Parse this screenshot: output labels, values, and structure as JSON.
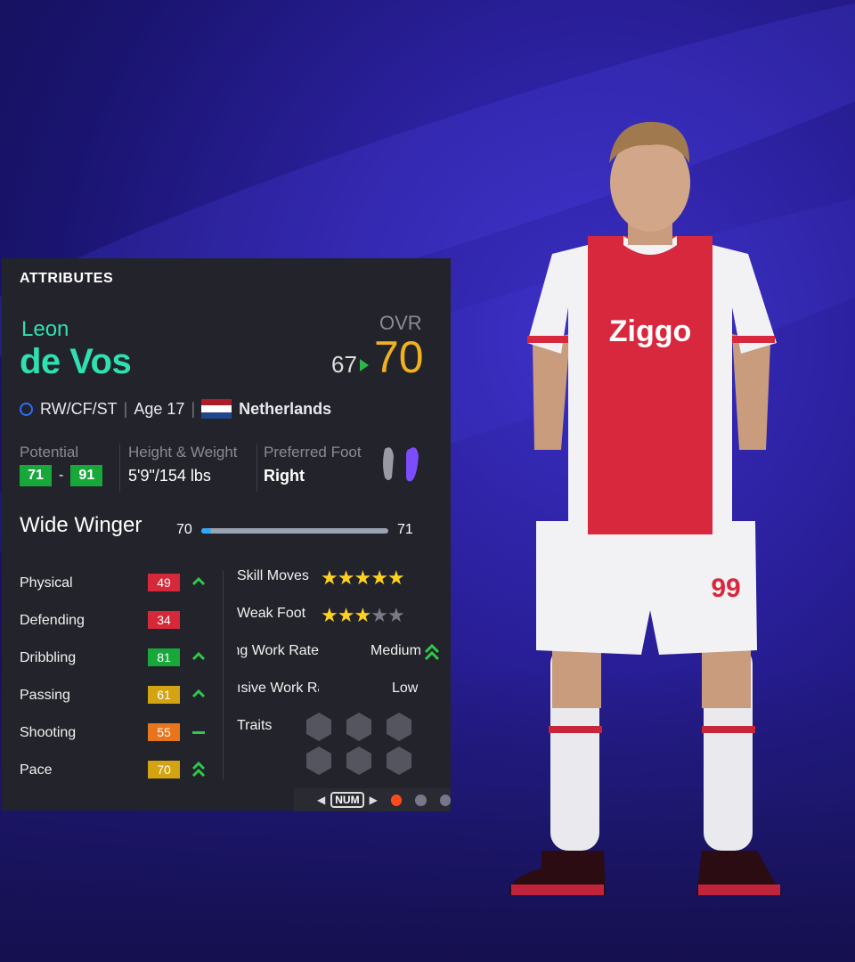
{
  "panel": {
    "title": "ATTRIBUTES"
  },
  "player": {
    "first_name": "Leon",
    "last_name": "de Vos",
    "ovr_label": "OVR",
    "ovr_old": "67",
    "ovr_new": "70",
    "positions": "RW/CF/ST",
    "age_label": "Age",
    "age": "17",
    "nationality": "Netherlands",
    "jersey_number": "99",
    "sponsor": "Ziggo"
  },
  "details": {
    "potential_label": "Potential",
    "potential_low": "71",
    "potential_high": "91",
    "height_weight_label": "Height & Weight",
    "height_weight": "5'9\"/154 lbs",
    "preferred_foot_label": "Preferred Foot",
    "preferred_foot": "Right"
  },
  "role": {
    "name": "Wide Winger",
    "low": "70",
    "high": 71,
    "progress": 0.05
  },
  "attributes": [
    {
      "name": "Physical",
      "value": "49",
      "color": "#d62839",
      "trend": "up"
    },
    {
      "name": "Defending",
      "value": "34",
      "color": "#d62839",
      "trend": "none"
    },
    {
      "name": "Dribbling",
      "value": "81",
      "color": "#18a83a",
      "trend": "up"
    },
    {
      "name": "Passing",
      "value": "61",
      "color": "#d4a312",
      "trend": "up"
    },
    {
      "name": "Shooting",
      "value": "55",
      "color": "#e8741c",
      "trend": "flat"
    },
    {
      "name": "Pace",
      "value": "70",
      "color": "#d4a312",
      "trend": "double-up"
    }
  ],
  "right_stats": {
    "skill_moves_label": "Skill Moves",
    "skill_moves_stars": 5,
    "weak_foot_label": "Weak Foot",
    "weak_foot_stars": 3,
    "attacking_wr_label": "king Work Rate",
    "attacking_wr": "Medium",
    "defensive_wr_label": "ısive Work Rate",
    "defensive_wr": "Low",
    "traits_label": "Traits"
  },
  "pager": {
    "num_label": "NUM",
    "active_page": 1,
    "pages": 3
  },
  "colors": {
    "accent": "#2fe0b0",
    "ovr": "#f0b020",
    "green": "#18a83a",
    "panel": "#23232b"
  }
}
